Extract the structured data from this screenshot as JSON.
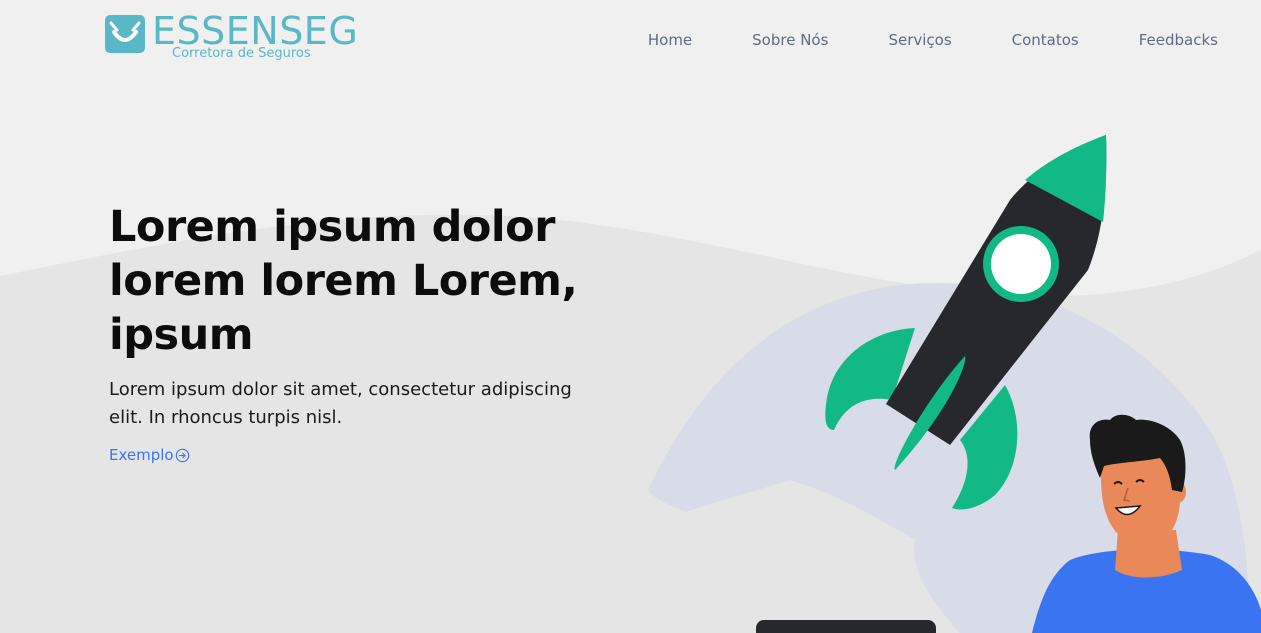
{
  "brand": {
    "name": "ESSENSEG",
    "tagline": "Corretora de Seguros",
    "accent": "#5ab8c6"
  },
  "nav": {
    "items": [
      {
        "label": "Home"
      },
      {
        "label": "Sobre Nós"
      },
      {
        "label": "Serviços"
      },
      {
        "label": "Contatos"
      },
      {
        "label": "Feedbacks"
      }
    ]
  },
  "hero": {
    "title": "Lorem ipsum dolor lorem lorem Lorem, ipsum",
    "text": "Lorem ipsum dolor sit amet, consectetur adipiscing elit. In rhoncus turpis nisl.",
    "cta_label": "Exemplo",
    "cta_icon": "arrow-circle-right-icon",
    "cta_color": "#3b74f0"
  },
  "illustration": {
    "rocket_body_color": "#27282d",
    "rocket_accent_color": "#12b886",
    "person_shirt_color": "#3b74f0"
  }
}
